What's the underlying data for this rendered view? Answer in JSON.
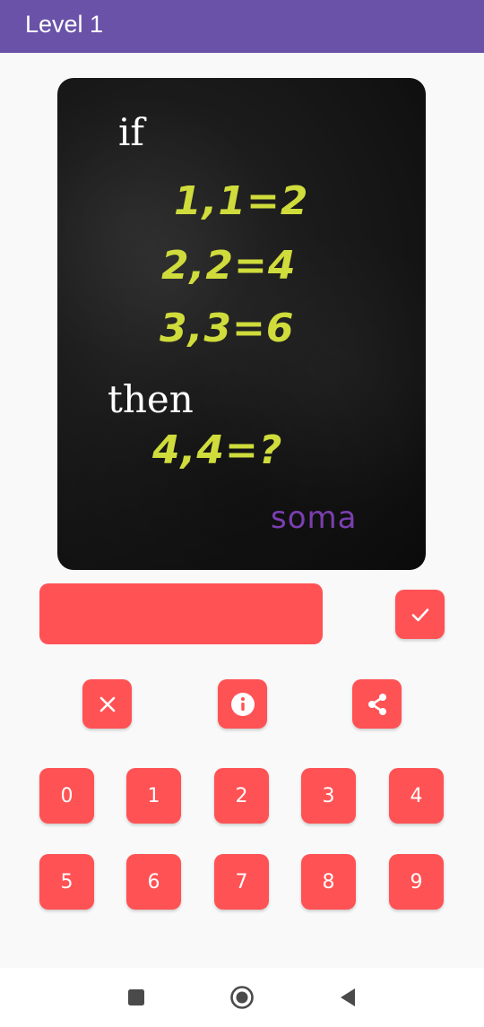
{
  "header": {
    "title": "Level 1"
  },
  "puzzle": {
    "line_if": "if",
    "equations": [
      "1,1=2",
      "2,2=4",
      "3,3=6"
    ],
    "line_then": "then",
    "question": "4,4=?",
    "brand": "soma"
  },
  "answer": {
    "value": ""
  },
  "actions": {
    "submit_icon": "check-icon",
    "clear_icon": "close-icon",
    "hint_icon": "info-icon",
    "share_icon": "share-icon"
  },
  "keypad": {
    "keys": [
      "0",
      "1",
      "2",
      "3",
      "4",
      "5",
      "6",
      "7",
      "8",
      "9"
    ]
  },
  "navbar": {
    "icons": [
      "recent-apps-icon",
      "home-icon",
      "back-icon"
    ]
  },
  "colors": {
    "header": "#6a52a8",
    "accent": "#ff5254",
    "equation": "#cfdc3c",
    "brand": "#7b3fb0",
    "background": "#f9f9f9"
  }
}
